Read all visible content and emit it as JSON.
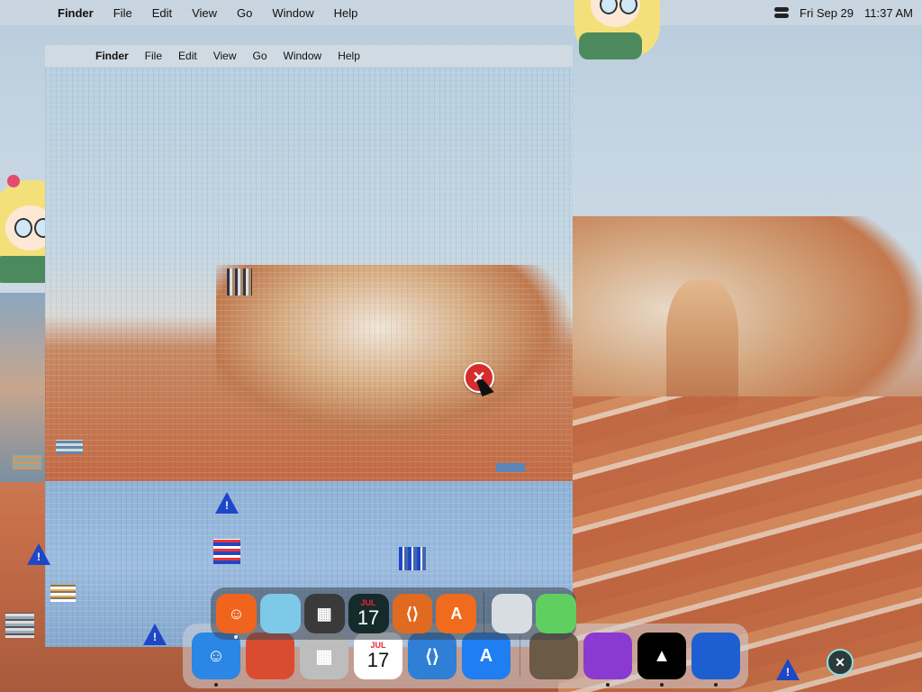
{
  "menubar": {
    "apple": "",
    "app": "Finder",
    "items": [
      "File",
      "Edit",
      "View",
      "Go",
      "Window",
      "Help"
    ],
    "date": "Fri Sep 29",
    "time": "11:37 AM"
  },
  "inner_menubar": {
    "apple": "",
    "app": "Finder",
    "items": [
      "File",
      "Edit",
      "View",
      "Go",
      "Window",
      "Help"
    ]
  },
  "warning_glyph": "!",
  "error_glyph": "✕",
  "dock_back": {
    "apps": [
      {
        "name": "finder-icon",
        "label": "☺",
        "color": "#2b86e6",
        "running": true
      },
      {
        "name": "firefox-icon",
        "label": "",
        "color": "#d94c2f",
        "running": false
      },
      {
        "name": "calculator-icon",
        "label": "▦",
        "color": "#bdbdbd",
        "running": false
      },
      {
        "name": "calendar-icon",
        "label": "17",
        "color": "#ffffff",
        "running": false
      },
      {
        "name": "vscode-icon",
        "label": "⟨⟩",
        "color": "#2f7fd6",
        "running": false
      },
      {
        "name": "app-store-icon",
        "label": "A",
        "color": "#1f7ef2",
        "running": false
      },
      {
        "name": "photo-icon",
        "label": "",
        "color": "#6b5a45",
        "running": false
      },
      {
        "name": "github-icon",
        "label": "",
        "color": "#8a3ad0",
        "running": true
      },
      {
        "name": "arc-icon",
        "label": "▲",
        "color": "#000000",
        "running": true
      },
      {
        "name": "ukraine-icon",
        "label": "",
        "color": "#1d5fd1",
        "running": true
      }
    ]
  },
  "dock_front": {
    "apps": [
      {
        "name": "finder-icon",
        "label": "☺",
        "color": "#f0641e",
        "running": true
      },
      {
        "name": "safari-icon",
        "label": "",
        "color": "#7fc9e8",
        "running": false
      },
      {
        "name": "calculator-icon",
        "label": "▦",
        "color": "#3a3a3a",
        "running": false
      },
      {
        "name": "calendar-icon",
        "label": "17",
        "color": "#152a2a",
        "running": false
      },
      {
        "name": "vscode-icon",
        "label": "⟨⟩",
        "color": "#e06a20",
        "running": false
      },
      {
        "name": "app-store-icon",
        "label": "A",
        "color": "#f06b1d",
        "running": false
      },
      {
        "name": "photo-icon",
        "label": "",
        "color": "#d8dde2",
        "running": false
      },
      {
        "name": "terminal-icon",
        "label": "",
        "color": "#5fd05f",
        "running": false
      }
    ]
  },
  "calendar_month": "JUL"
}
